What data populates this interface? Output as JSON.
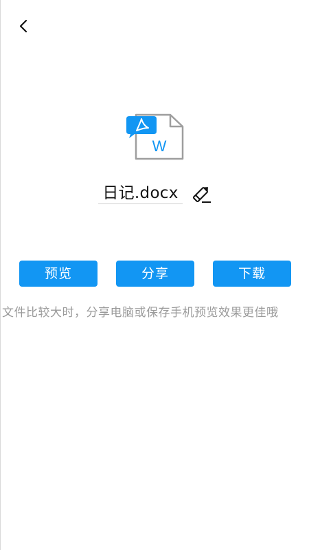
{
  "header": {
    "back_icon": "chevron-left-icon"
  },
  "file": {
    "icon": "pdf-to-word-icon",
    "pdf_badge_color": "#1296f3",
    "word_letter": "W",
    "name": "日记.docx",
    "edit_icon": "pencil-edit-icon"
  },
  "actions": {
    "preview_label": "预览",
    "share_label": "分享",
    "download_label": "下载",
    "button_color": "#1296f3"
  },
  "hint": {
    "text": "文件比较大时，分享电脑或保存手机预览效果更佳哦"
  }
}
